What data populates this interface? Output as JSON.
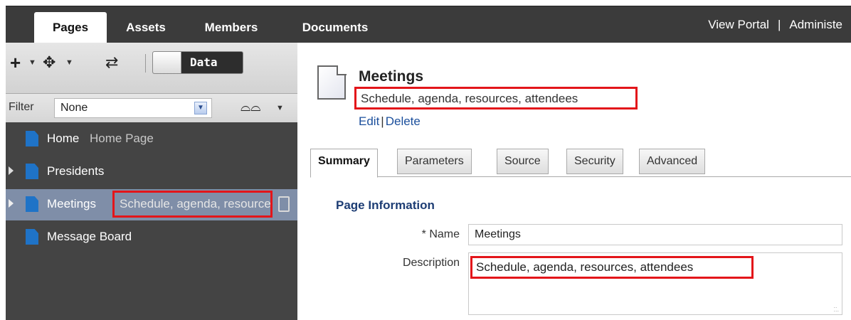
{
  "topbar": {
    "tabs": [
      "Pages",
      "Assets",
      "Members",
      "Documents"
    ],
    "active_tab": "Pages",
    "links": [
      "View Portal",
      "Administe"
    ],
    "separator": "|"
  },
  "left": {
    "toolbar": {
      "add_icon": "plus-icon",
      "move_icon": "move-icon",
      "refresh_icon": "refresh-icon",
      "toggle_label": "Data"
    },
    "filter": {
      "label": "Filter",
      "value": "None"
    },
    "tree": [
      {
        "name": "Home",
        "desc": "Home Page",
        "expandable": false,
        "selected": false
      },
      {
        "name": "Presidents",
        "desc": "",
        "expandable": true,
        "selected": false
      },
      {
        "name": "Meetings",
        "desc": "Schedule, agenda, resources, attendees",
        "expandable": true,
        "selected": true
      },
      {
        "name": "Message Board",
        "desc": "",
        "expandable": false,
        "selected": false
      }
    ]
  },
  "right": {
    "title": "Meetings",
    "subtitle": "Schedule, agenda, resources, attendees",
    "links": {
      "edit": "Edit",
      "sep": "|",
      "delete": "Delete"
    },
    "tabs": [
      "Summary",
      "Parameters",
      "Source",
      "Security",
      "Advanced"
    ],
    "active_tab": "Summary",
    "section_title": "Page Information",
    "form": {
      "name_label": "Name",
      "required_mark": "*",
      "name_value": "Meetings",
      "desc_label": "Description",
      "desc_value": "Schedule, agenda, resources, attendees"
    }
  },
  "colors": {
    "highlight": "#e3151a",
    "topbar": "#3b3b3b",
    "tree_bg": "#444444",
    "selected_row": "#7f8ea8",
    "page_icon": "#1f73c7",
    "link": "#1b4f9c"
  }
}
